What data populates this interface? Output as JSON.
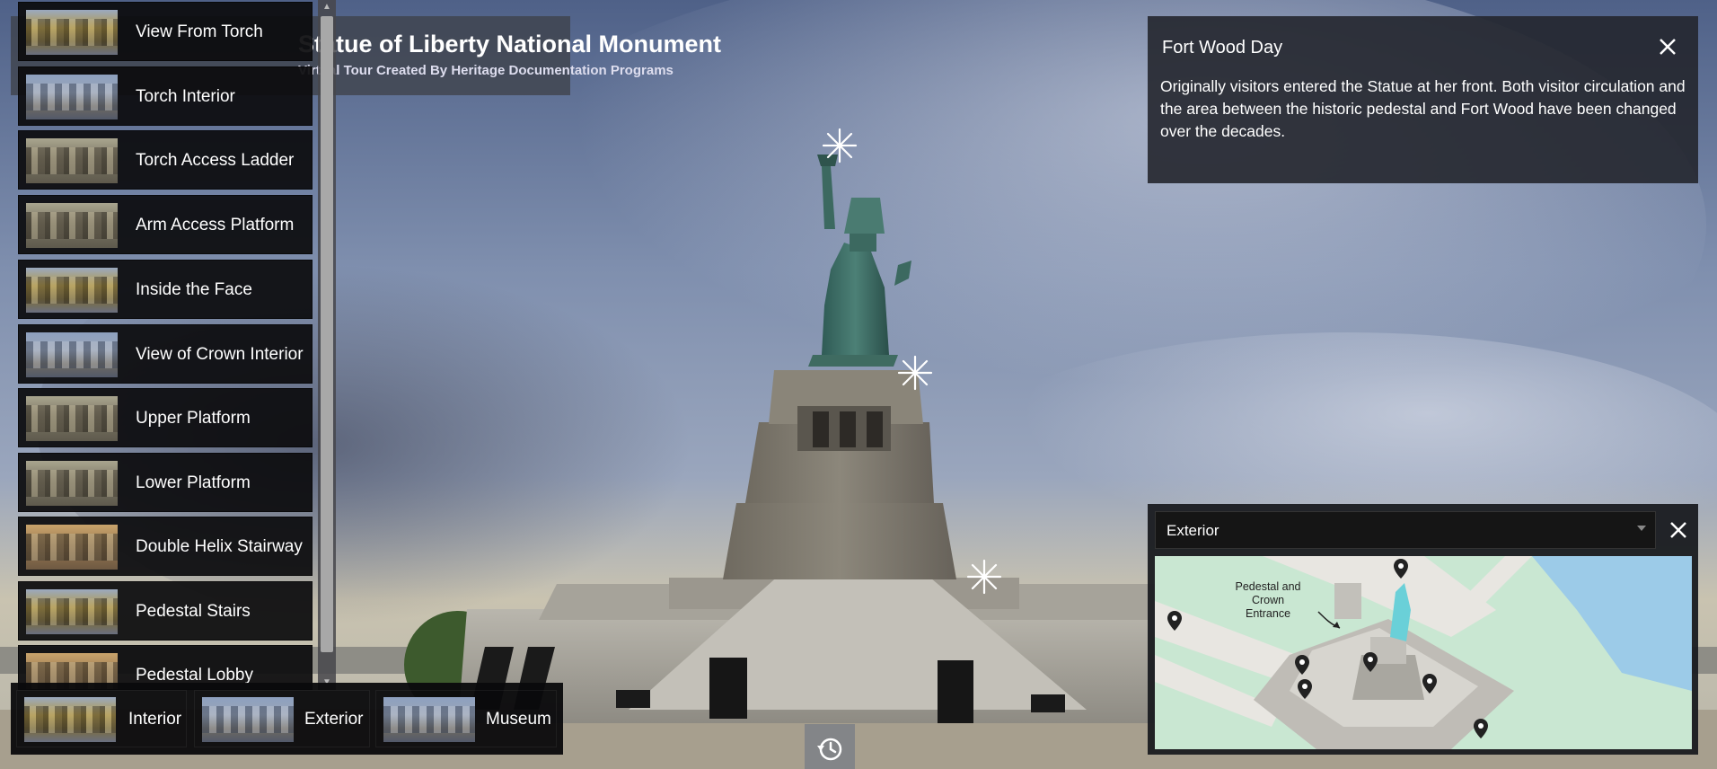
{
  "window": {
    "title": "Statue of Liberty National Monument",
    "subtitle": "Virtual Tour Created By Heritage Documentation Programs"
  },
  "scene_list": {
    "items": [
      {
        "label": "View From Torch",
        "thumb": "gold"
      },
      {
        "label": "Torch Interior",
        "thumb": "blue"
      },
      {
        "label": "Torch Access Ladder",
        "thumb": "plain"
      },
      {
        "label": "Arm Access Platform",
        "thumb": "plain"
      },
      {
        "label": "Inside the Face",
        "thumb": "gold"
      },
      {
        "label": "View of Crown Interior",
        "thumb": "blue"
      },
      {
        "label": "Upper Platform",
        "thumb": "plain"
      },
      {
        "label": "Lower Platform",
        "thumb": "plain"
      },
      {
        "label": "Double Helix Stairway",
        "thumb": "warm"
      },
      {
        "label": "Pedestal Stairs",
        "thumb": "gold"
      },
      {
        "label": "Pedestal Lobby",
        "thumb": "warm"
      }
    ]
  },
  "categories": [
    {
      "label": "Interior",
      "thumb": "gold"
    },
    {
      "label": "Exterior",
      "thumb": "blue"
    },
    {
      "label": "Museum",
      "thumb": "blue"
    }
  ],
  "info_panel": {
    "title": "Fort Wood Day",
    "body": "Originally visitors entered the Statue at her front. Both visitor circulation and the area between the historic pedestal and Fort Wood have been changed over the decades."
  },
  "map_panel": {
    "select_value": "Exterior",
    "caption": "Pedestal and Crown Entrance",
    "colors": {
      "lawn": "#c9e7d2",
      "water": "#9ccbe8",
      "path": "#e8e6e1",
      "pin": "#222222"
    }
  },
  "icons": {
    "hotspot": "hotspot-sparkle-icon",
    "history": "history-icon",
    "close": "close-icon",
    "pin": "map-pin-icon"
  }
}
